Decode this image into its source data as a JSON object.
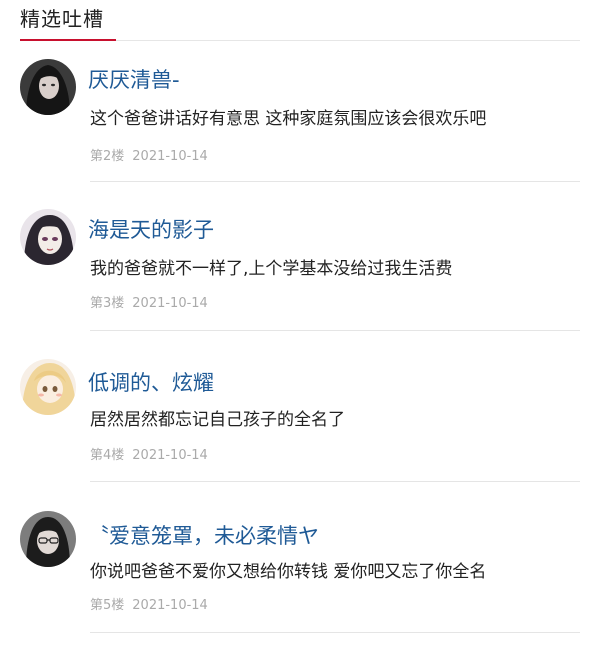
{
  "section": {
    "title": "精选吐槽"
  },
  "comments": [
    {
      "username": "厌厌清兽-",
      "text": "这个爸爸讲话好有意思  这种家庭氛围应该会很欢乐吧",
      "floor": "第2楼",
      "date": "2021-10-14"
    },
    {
      "username": "海是天的影子",
      "text": "我的爸爸就不一样了,上个学基本没给过我生活费",
      "floor": "第3楼",
      "date": "2021-10-14"
    },
    {
      "username": "低调的、炫耀",
      "text": "居然居然都忘记自己孩子的全名了",
      "floor": "第4楼",
      "date": "2021-10-14"
    },
    {
      "username": "〝爱意笼罩，未必柔情ヤ",
      "text": "你说吧爸爸不爱你又想给你转钱 爱你吧又忘了你全名",
      "floor": "第5楼",
      "date": "2021-10-14"
    }
  ],
  "colors": {
    "username": "#1f5a96",
    "accent_underline": "#c8102e",
    "meta": "#aaaaaa"
  }
}
